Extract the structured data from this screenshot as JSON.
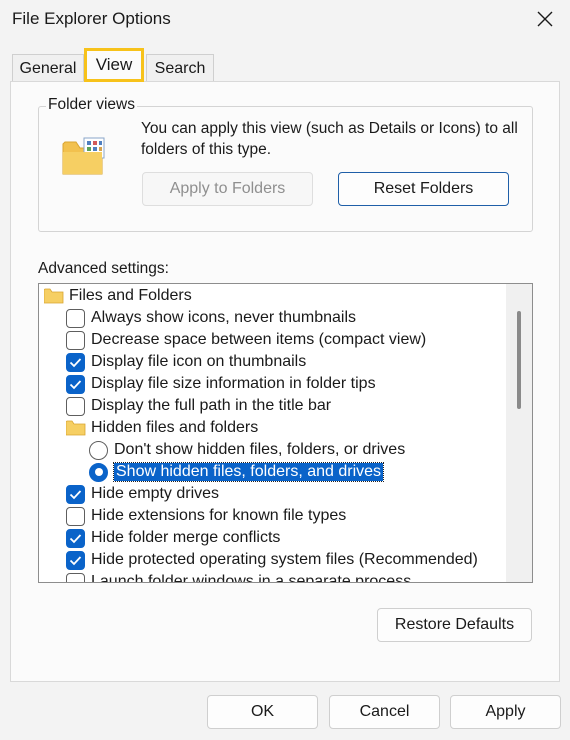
{
  "window": {
    "title": "File Explorer Options"
  },
  "tabs": [
    {
      "label": "General"
    },
    {
      "label": "View"
    },
    {
      "label": "Search"
    }
  ],
  "folder_views": {
    "legend": "Folder views",
    "description": "You can apply this view (such as Details or Icons) to all folders of this type.",
    "apply_button": "Apply to Folders",
    "reset_button": "Reset Folders"
  },
  "advanced": {
    "label": "Advanced settings:",
    "items": [
      {
        "type": "folder",
        "label": "Files and Folders"
      },
      {
        "type": "checkbox",
        "checked": false,
        "label": "Always show icons, never thumbnails"
      },
      {
        "type": "checkbox",
        "checked": false,
        "label": "Decrease space between items (compact view)"
      },
      {
        "type": "checkbox",
        "checked": true,
        "label": "Display file icon on thumbnails"
      },
      {
        "type": "checkbox",
        "checked": true,
        "label": "Display file size information in folder tips"
      },
      {
        "type": "checkbox",
        "checked": false,
        "label": "Display the full path in the title bar"
      },
      {
        "type": "folder",
        "label": "Hidden files and folders"
      },
      {
        "type": "radio",
        "checked": false,
        "label": "Don't show hidden files, folders, or drives"
      },
      {
        "type": "radio",
        "checked": true,
        "label": "Show hidden files, folders, and drives"
      },
      {
        "type": "checkbox",
        "checked": true,
        "label": "Hide empty drives"
      },
      {
        "type": "checkbox",
        "checked": false,
        "label": "Hide extensions for known file types"
      },
      {
        "type": "checkbox",
        "checked": true,
        "label": "Hide folder merge conflicts"
      },
      {
        "type": "checkbox",
        "checked": true,
        "label": "Hide protected operating system files (Recommended)"
      },
      {
        "type": "checkbox",
        "checked": false,
        "label": "Launch folder windows in a separate process"
      }
    ]
  },
  "buttons": {
    "restore": "Restore Defaults",
    "ok": "OK",
    "cancel": "Cancel",
    "apply": "Apply"
  },
  "colors": {
    "accent": "#0a63c9",
    "highlight_border": "#f7c21a"
  },
  "icons": {
    "close": "close-icon",
    "folder": "folder-icon",
    "checkmark": "checkmark-icon"
  }
}
